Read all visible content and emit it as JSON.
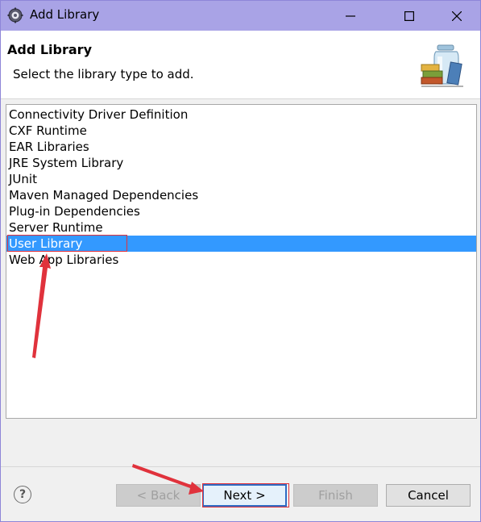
{
  "window": {
    "title": "Add Library"
  },
  "header": {
    "title": "Add Library",
    "description": "Select the library type to add."
  },
  "library_types": [
    "Connectivity Driver Definition",
    "CXF Runtime",
    "EAR Libraries",
    "JRE System Library",
    "JUnit",
    "Maven Managed Dependencies",
    "Plug-in Dependencies",
    "Server Runtime",
    "User Library",
    "Web App Libraries"
  ],
  "selected_index": 8,
  "buttons": {
    "help": "?",
    "back": "< Back",
    "next": "Next >",
    "finish": "Finish",
    "cancel": "Cancel"
  },
  "colors": {
    "titlebar": "#a9a3e6",
    "selection": "#3399ff",
    "annotation": "#e0323c"
  }
}
